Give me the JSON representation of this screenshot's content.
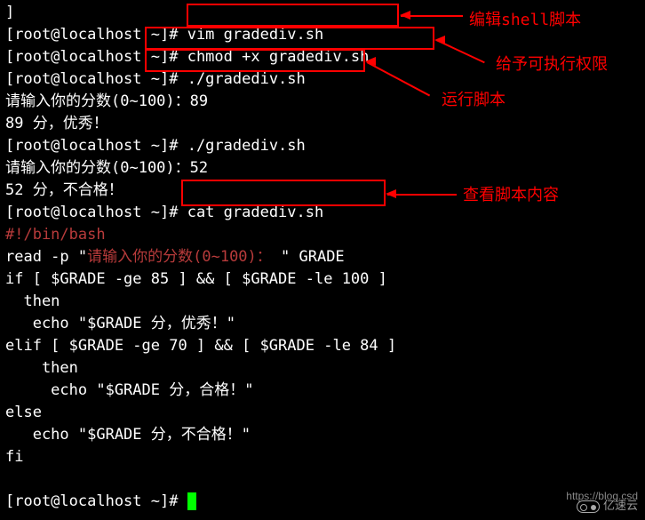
{
  "prompt": "[root@localhost ~]#",
  "lines": {
    "l0": "]",
    "l1_cmd": " vim gradediv.sh",
    "l2_cmd": " chmod +x gradediv.sh",
    "l3_cmd": " ./gradediv.sh",
    "l4": "请输入你的分数(0~100)：89",
    "l5": "89 分，优秀！",
    "l6_cmd": " ./gradediv.sh",
    "l7": "请输入你的分数(0~100)：52",
    "l8": "52 分，不合格！",
    "l9_cmd": " cat gradediv.sh",
    "l10": "#!/bin/bash",
    "l11a": "read -p \"",
    "l11b": "请输入你的分数(0~100)：",
    "l11c": " \" GRADE",
    "l12": "if [ $GRADE -ge 85 ] && [ $GRADE -le 100 ]",
    "l13": "  then",
    "l14": "   echo \"$GRADE 分，优秀！\"",
    "l15": "elif [ $GRADE -ge 70 ] && [ $GRADE -le 84 ]",
    "l16": "    then",
    "l17": "     echo \"$GRADE 分，合格！\"",
    "l18": "else",
    "l19": "   echo \"$GRADE 分，不合格！\"",
    "l20": "fi",
    "blank": " "
  },
  "annotations": {
    "a1": "编辑shell脚本",
    "a2": "给予可执行权限",
    "a3": "运行脚本",
    "a4": "查看脚本内容"
  },
  "watermark": {
    "url": "https://blog.csd",
    "brand": "亿速云"
  }
}
